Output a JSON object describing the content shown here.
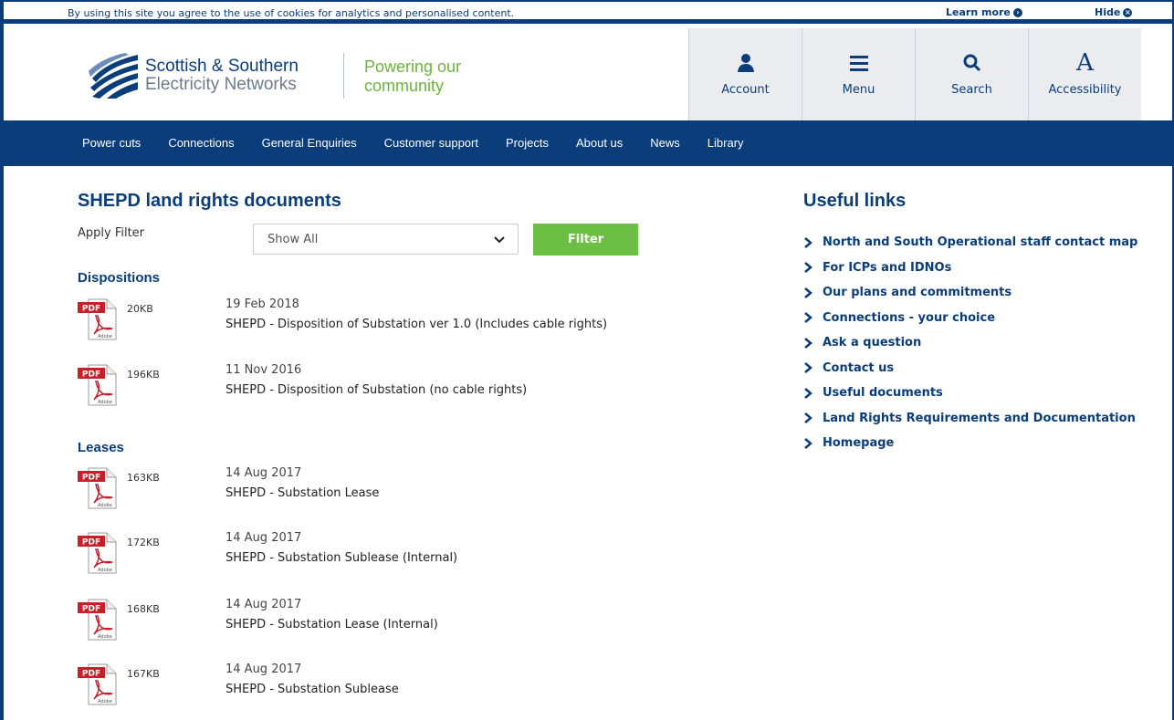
{
  "cookie": {
    "message": "By using this site you agree to the use of cookies for analytics and personalised content.",
    "learn_more": "Learn more",
    "hide": "Hide"
  },
  "header": {
    "brand_line1": "Scottish & Southern",
    "brand_line2": "Electricity Networks",
    "tagline_line1": "Powering our",
    "tagline_line2": "community",
    "buttons": [
      {
        "label": "Account",
        "icon": "user-icon"
      },
      {
        "label": "Menu",
        "icon": "hamburger-icon"
      },
      {
        "label": "Search",
        "icon": "search-icon"
      },
      {
        "label": "Accessibility",
        "icon": "accessibility-a-icon"
      }
    ]
  },
  "nav": {
    "items": [
      "Power cuts",
      "Connections",
      "General Enquiries",
      "Customer support",
      "Projects",
      "About us",
      "News",
      "Library"
    ]
  },
  "main": {
    "title": "SHEPD land rights documents",
    "apply_filter": "Apply Filter",
    "filter_select_value": "Show All",
    "filter_button": "Filter",
    "sections": [
      {
        "heading": "Dispositions",
        "docs": [
          {
            "size": "20KB",
            "date": "19 Feb 2018",
            "title": "SHEPD - Disposition of Substation ver 1.0 (Includes cable rights)"
          },
          {
            "size": "196KB",
            "date": "11 Nov 2016",
            "title": "SHEPD - Disposition of Substation (no cable rights)"
          }
        ]
      },
      {
        "heading": "Leases",
        "docs": [
          {
            "size": "163KB",
            "date": "14 Aug 2017",
            "title": "SHEPD - Substation Lease"
          },
          {
            "size": "172KB",
            "date": "14 Aug 2017",
            "title": "SHEPD - Substation Sublease (Internal)"
          },
          {
            "size": "168KB",
            "date": "14 Aug 2017",
            "title": "SHEPD - Substation Lease (Internal)"
          },
          {
            "size": "167KB",
            "date": "14 Aug 2017",
            "title": "SHEPD - Substation Sublease"
          }
        ]
      }
    ],
    "pdf_badge": "PDF",
    "adobe_label": "Adobe"
  },
  "useful_links": {
    "title": "Useful links",
    "items": [
      "North and South Operational staff contact map",
      "For ICPs and IDNOs",
      "Our plans and commitments",
      "Connections - your choice",
      "Ask a question",
      "Contact us",
      "Useful documents",
      "Land Rights Requirements and Documentation",
      "Homepage"
    ]
  },
  "colors": {
    "brand_blue": "#0a3d7a",
    "brand_green": "#6cbf44",
    "pdf_red": "#c8202a"
  }
}
